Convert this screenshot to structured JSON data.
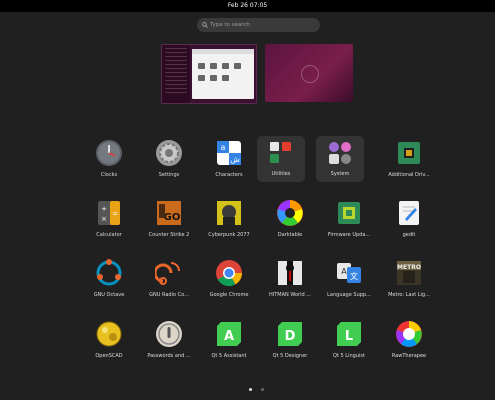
{
  "topbar": {
    "datetime": "Feb 26  07:05"
  },
  "search": {
    "placeholder": "Type to search"
  },
  "apps": [
    {
      "label": "Clocks",
      "icon": "clock-icon"
    },
    {
      "label": "Settings",
      "icon": "gear-icon"
    },
    {
      "label": "Characters",
      "icon": "characters-icon"
    },
    {
      "label": "Utilities",
      "icon": "utilities-folder-icon"
    },
    {
      "label": "System",
      "icon": "system-folder-icon"
    },
    {
      "label": "Additional Driv...",
      "icon": "chip-icon"
    },
    {
      "label": "Calculator",
      "icon": "calculator-icon"
    },
    {
      "label": "Counter Strike 2",
      "icon": "cs2-icon"
    },
    {
      "label": "Cyberpunk 2077",
      "icon": "cyberpunk-icon"
    },
    {
      "label": "Darktable",
      "icon": "darktable-icon"
    },
    {
      "label": "Firmware Upda...",
      "icon": "firmware-icon"
    },
    {
      "label": "gedit",
      "icon": "text-editor-icon"
    },
    {
      "label": "GNU Octave",
      "icon": "octave-icon"
    },
    {
      "label": "GNU Radio Co...",
      "icon": "gnuradio-icon"
    },
    {
      "label": "Google Chrome",
      "icon": "chrome-icon"
    },
    {
      "label": "HITMAN World ...",
      "icon": "hitman-icon"
    },
    {
      "label": "Language Supp...",
      "icon": "language-icon"
    },
    {
      "label": "Metro: Last Lig...",
      "icon": "metro-icon"
    },
    {
      "label": "OpenSCAD",
      "icon": "openscad-icon"
    },
    {
      "label": "Passwords and ...",
      "icon": "passwords-icon"
    },
    {
      "label": "Qt 5 Assistant",
      "icon": "qt-assistant-icon"
    },
    {
      "label": "Qt 5 Designer",
      "icon": "qt-designer-icon"
    },
    {
      "label": "Qt 5 Linguist",
      "icon": "qt-linguist-icon"
    },
    {
      "label": "RawTherapee",
      "icon": "rawtherapee-icon"
    }
  ],
  "pagination": {
    "current": 1,
    "total": 2
  },
  "colors": {
    "background": "#202020",
    "topbar": "#000000",
    "accent_qt": "#41cd52"
  }
}
